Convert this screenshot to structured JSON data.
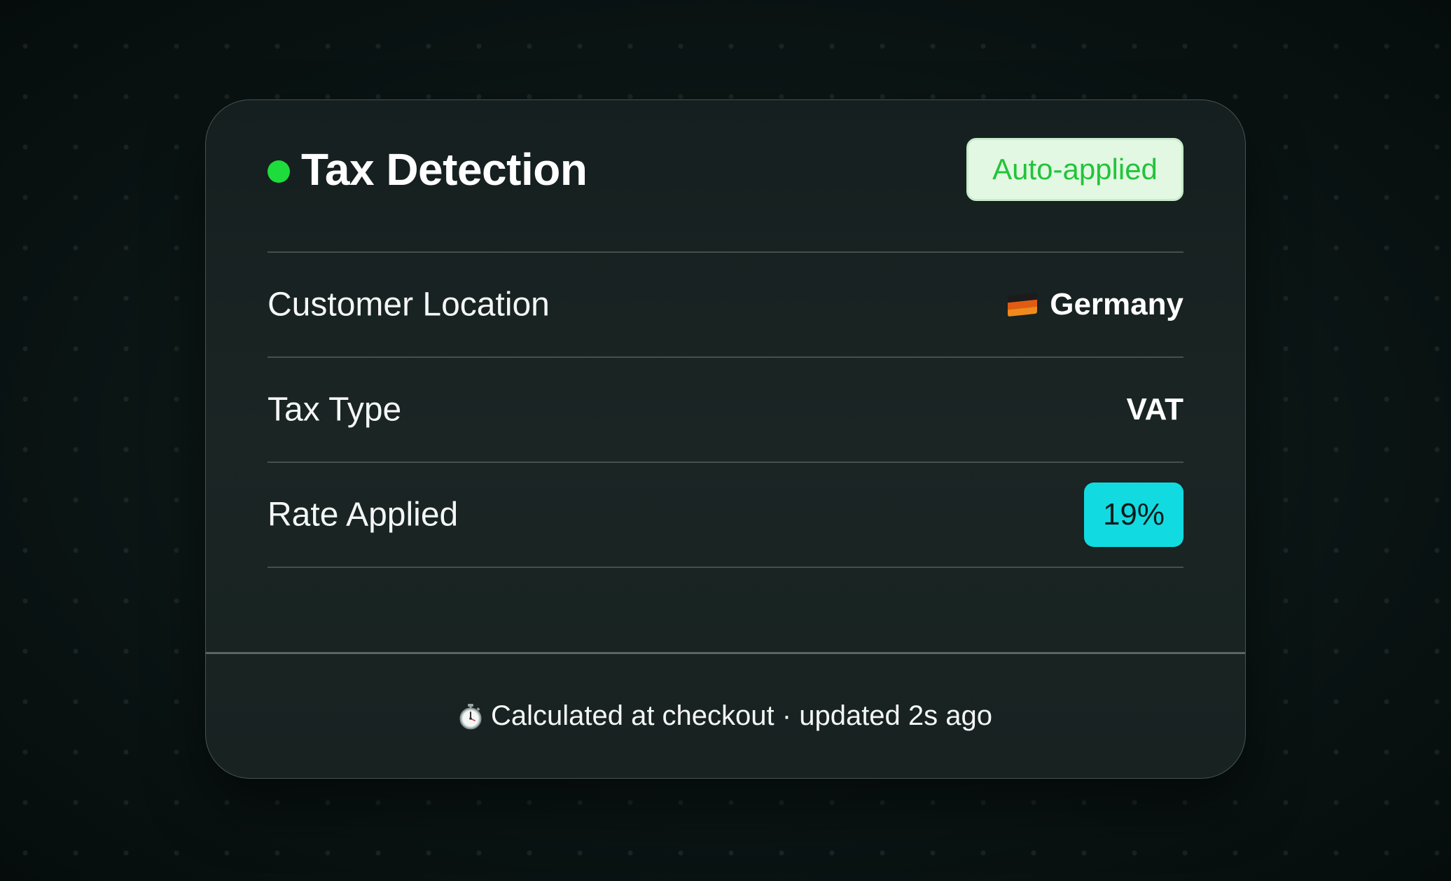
{
  "card": {
    "title": "Tax Detection",
    "status_badge": "Auto-applied",
    "rows": [
      {
        "label": "Customer Location",
        "value": "Germany"
      },
      {
        "label": "Tax Type",
        "value": "VAT"
      },
      {
        "label": "Rate Applied",
        "value": "19%"
      }
    ],
    "footer_text": "Calculated at checkout · updated 2s ago"
  },
  "colors": {
    "status_dot": "#1edc3b",
    "badge_text": "#22c43a",
    "badge_bg": "#e3f8e3",
    "rate_badge_bg": "#11dbe0"
  },
  "icons": {
    "status": "status-dot",
    "location": "germany-flag-icon",
    "footer": "stopwatch-icon"
  }
}
